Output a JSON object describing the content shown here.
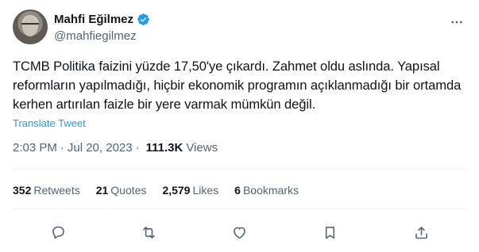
{
  "author": {
    "display_name": "Mahfi Eğilmez",
    "handle": "@mahfiegilmez",
    "verified_icon": "verified-badge-icon",
    "accent_color": "#1d9bf0"
  },
  "tweet": {
    "text": "TCMB Politika faizini yüzde 17,50'ye çıkardı. Zahmet oldu aslında. Yapısal reformların yapılmadığı, hiçbir ekonomik programın açıklanmadığı bir ortamda kerhen artırılan faizle bir yere varmak mümkün değil.",
    "translate_label": "Translate Tweet",
    "time": "2:03 PM",
    "separator": "·",
    "date": "Jul 20, 2023",
    "views_count": "111.3K",
    "views_label": "Views"
  },
  "stats": {
    "retweets_count": "352",
    "retweets_label": "Retweets",
    "quotes_count": "21",
    "quotes_label": "Quotes",
    "likes_count": "2,579",
    "likes_label": "Likes",
    "bookmarks_count": "6",
    "bookmarks_label": "Bookmarks"
  },
  "actions": [
    "reply-icon",
    "retweet-icon",
    "like-icon",
    "bookmark-icon",
    "share-icon"
  ]
}
